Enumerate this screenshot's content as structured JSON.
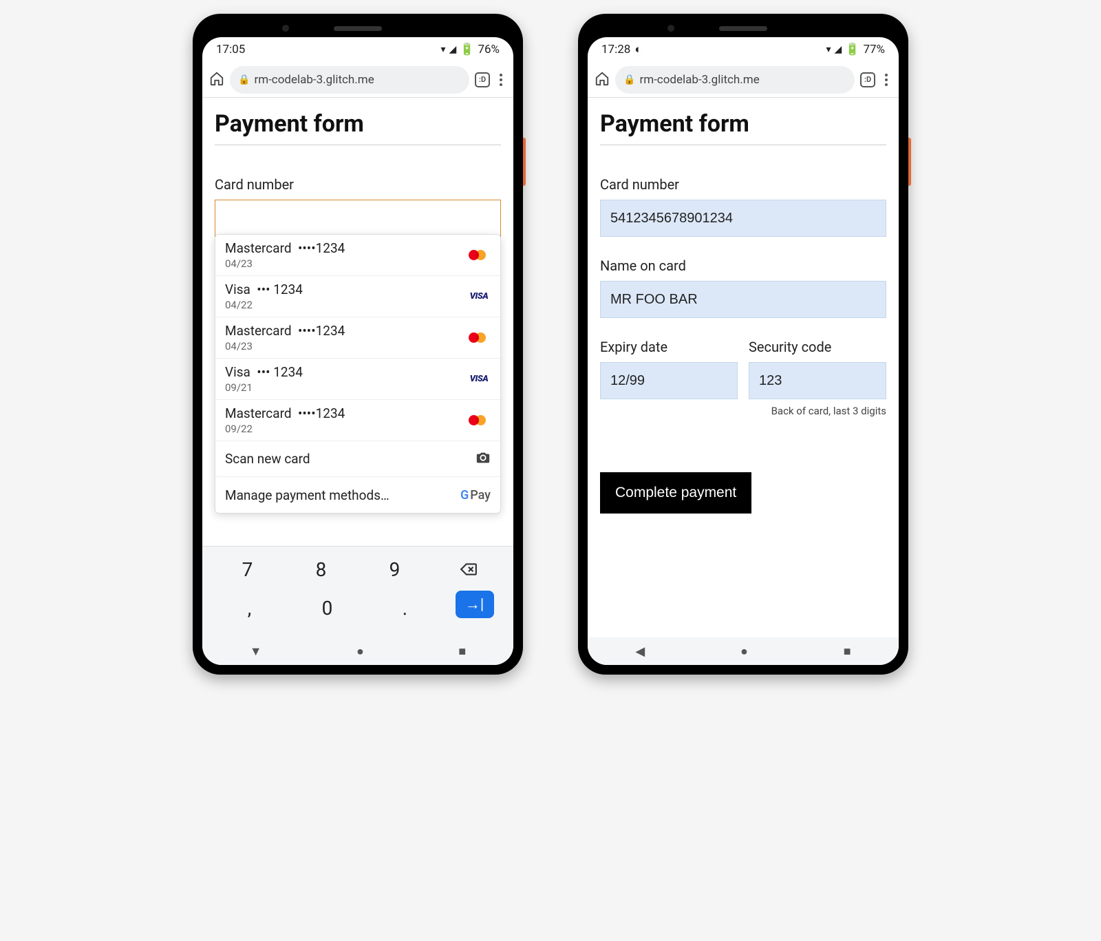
{
  "phones": {
    "left": {
      "status": {
        "time": "17:05",
        "battery_text": "76%"
      },
      "url": "rm-codelab-3.glitch.me",
      "tab_badge": ":D",
      "title": "Payment form",
      "card_number_label": "Card number",
      "autofill": {
        "cards": [
          {
            "brand": "Mastercard",
            "mask": "••••1234",
            "exp": "04/23",
            "logo": "mc"
          },
          {
            "brand": "Visa",
            "mask": "••• 1234",
            "exp": "04/22",
            "logo": "visa"
          },
          {
            "brand": "Mastercard",
            "mask": "••••1234",
            "exp": "04/23",
            "logo": "mc"
          },
          {
            "brand": "Visa",
            "mask": "••• 1234",
            "exp": "09/21",
            "logo": "visa"
          },
          {
            "brand": "Mastercard",
            "mask": "••••1234",
            "exp": "09/22",
            "logo": "mc"
          }
        ],
        "scan_label": "Scan new card",
        "manage_label": "Manage payment methods…",
        "gpay_text": "Pay"
      },
      "keyboard": {
        "row1": [
          "7",
          "8",
          "9"
        ],
        "row2": [
          ",",
          "0",
          "."
        ]
      }
    },
    "right": {
      "status": {
        "time": "17:28",
        "battery_text": "77%"
      },
      "url": "rm-codelab-3.glitch.me",
      "tab_badge": ":D",
      "title": "Payment form",
      "fields": {
        "card_number_label": "Card number",
        "card_number_value": "5412345678901234",
        "name_label": "Name on card",
        "name_value": "MR FOO BAR",
        "expiry_label": "Expiry date",
        "expiry_value": "12/99",
        "cvc_label": "Security code",
        "cvc_value": "123",
        "cvc_hint": "Back of card, last 3 digits"
      },
      "submit_label": "Complete payment"
    }
  }
}
